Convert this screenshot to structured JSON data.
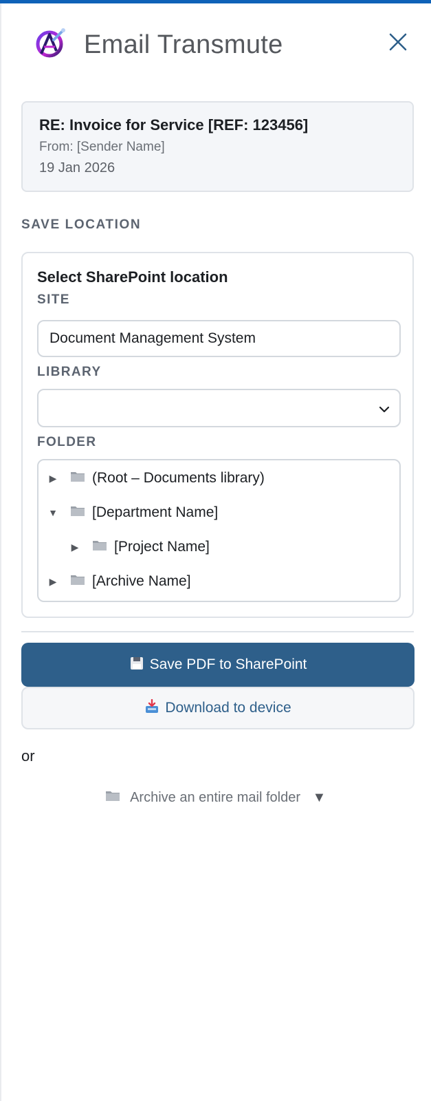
{
  "app": {
    "title": "Email Transmute"
  },
  "email": {
    "subject": "RE: Invoice for Service [REF: 123456]",
    "from": "From: [Sender Name]",
    "date": "19 Jan 2026"
  },
  "save_location": {
    "section_title": "SAVE LOCATION",
    "heading": "Select SharePoint location",
    "site_label": "SITE",
    "site_value": "Document Management System",
    "library_label": "LIBRARY",
    "library_value": "",
    "folder_label": "FOLDER",
    "folders": [
      {
        "label": "(Root – Documents library)",
        "toggle": "▶",
        "expanded": false,
        "depth": 0
      },
      {
        "label": "[Department Name]",
        "toggle": "▼",
        "expanded": true,
        "depth": 0
      },
      {
        "label": "[Project Name]",
        "toggle": "▶",
        "expanded": false,
        "depth": 1
      },
      {
        "label": "[Archive Name]",
        "toggle": "▶",
        "expanded": false,
        "depth": 0
      }
    ]
  },
  "actions": {
    "save_label": "Save PDF to SharePoint",
    "download_label": "Download to device",
    "or_text": "or",
    "archive_label": "Archive an entire mail folder",
    "archive_arrow": "▼"
  },
  "colors": {
    "accent": "#2e5f8a",
    "top_bar": "#0f62b8",
    "card_bg": "#f4f6f9",
    "border": "#dfe3e8"
  },
  "icons": {
    "logo": "app-logo-icon",
    "close": "close-icon",
    "chevron": "chevron-down-icon",
    "folder": "folder-icon",
    "save": "floppy-disk-icon",
    "download": "download-tray-icon"
  }
}
